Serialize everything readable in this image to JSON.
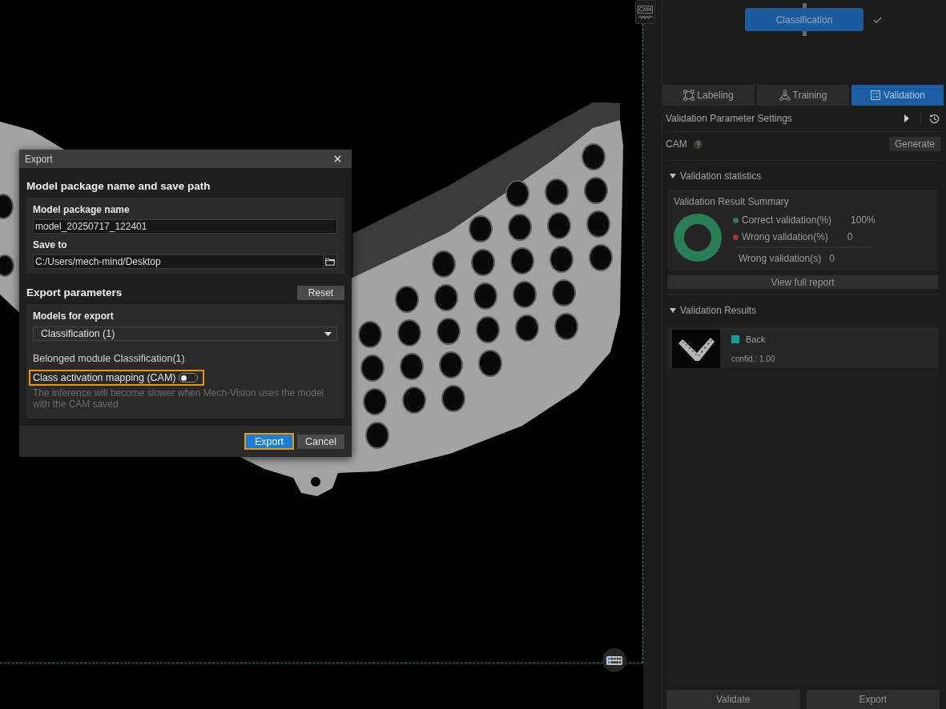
{
  "viewer": {
    "cam_button": {
      "label": "CAM"
    }
  },
  "export_dialog": {
    "title": "Export",
    "path_section": {
      "heading": "Model package name and save path",
      "name_field": {
        "label": "Model package name",
        "value": "model_20250717_122401"
      },
      "path_field": {
        "label": "Save to",
        "value": "C:/Users/mech-mind/Desktop"
      }
    },
    "params_section": {
      "heading": "Export parameters",
      "reset_button": "Reset",
      "models_field": {
        "label": "Models for export",
        "value": "Classification (1)"
      },
      "module_text": "Belonged module Classification(1)",
      "cam_toggle": {
        "label": "Class activation mapping (CAM)",
        "on": false,
        "highlighted": true
      },
      "hint": "The inference will become slower when Mech-Vision uses the model with the CAM saved"
    },
    "buttons": [
      {
        "label": "Export",
        "kind": "primary",
        "highlighted": true
      },
      {
        "label": "Cancel",
        "kind": "secondary",
        "highlighted": false
      }
    ]
  },
  "right_panel": {
    "module_node": {
      "label": "Classification",
      "done": true
    },
    "tabs": [
      {
        "label": "Labeling",
        "selected": false
      },
      {
        "label": "Training",
        "selected": false
      },
      {
        "label": "Validation",
        "selected": true
      }
    ],
    "parameter_settings": {
      "title": "Validation Parameter Settings"
    },
    "cam_row": {
      "label": "CAM",
      "button": "Generate"
    },
    "statistics": {
      "title": "Validation statistics",
      "expanded": true,
      "summary": {
        "title": "Validation Result Summary",
        "correct_ring": {
          "level": 1
        },
        "legend": [
          {
            "label": "Correct validation(%)",
            "value": "100%",
            "color": "#2b7d57"
          },
          {
            "label": "Wrong validation(%)",
            "value": "0",
            "color": "#9a3a2c"
          }
        ],
        "wrong_count": {
          "label": "Wrong validation(s)",
          "value": "0"
        }
      },
      "report_button": "View full report"
    },
    "results": {
      "title": "Validation Results",
      "expanded": true,
      "items": [
        {
          "label": "Back",
          "color": "#169a98",
          "confidence": "confid.: 1.00"
        }
      ]
    },
    "buttons": [
      "Validate",
      "Export"
    ]
  }
}
